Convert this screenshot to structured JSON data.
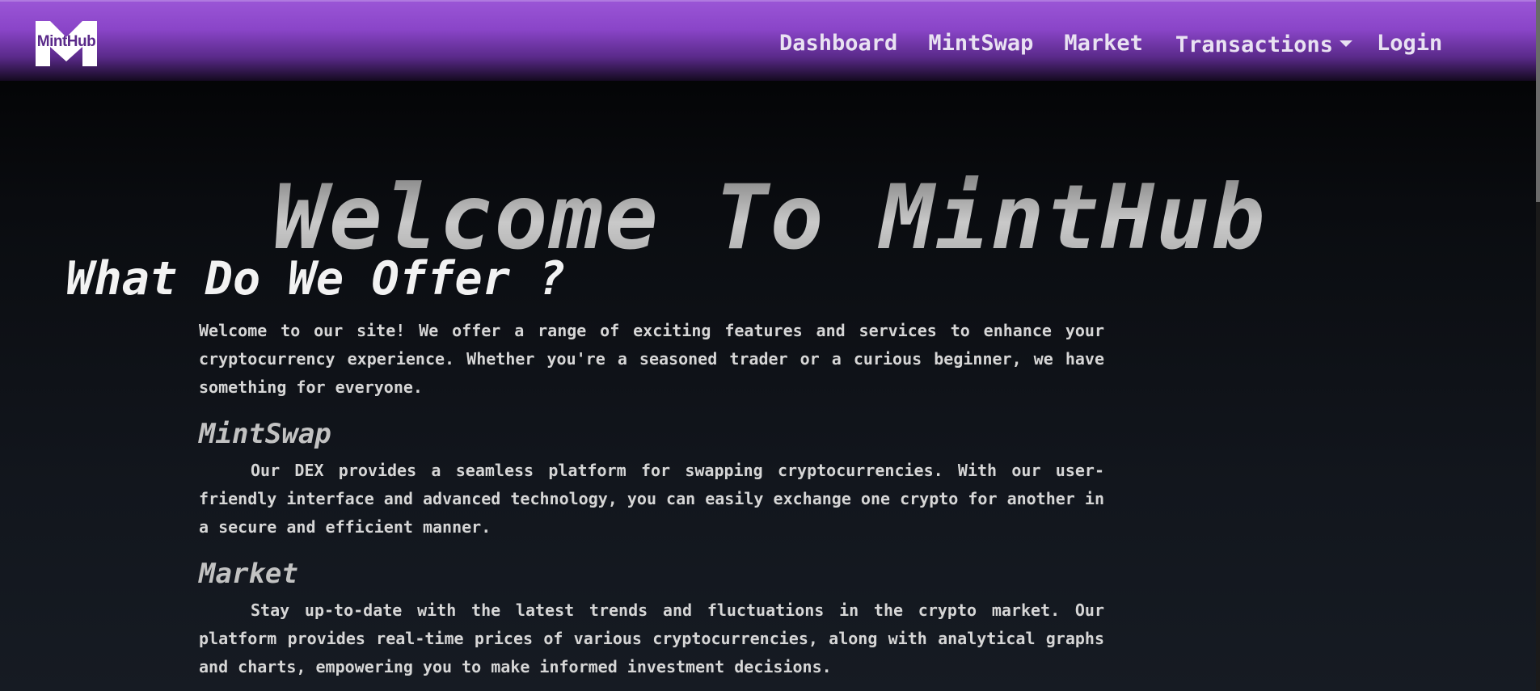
{
  "brand": {
    "logo_letter": "M",
    "logo_text": "MintHub"
  },
  "nav": {
    "dashboard": "Dashboard",
    "mintswap": "MintSwap",
    "market": "Market",
    "transactions": "Transactions",
    "login": "Login"
  },
  "hero": {
    "title": "Welcome To MintHub"
  },
  "offer": {
    "heading": "What Do We Offer ?",
    "intro": "Welcome to our site! We offer a range of exciting features and services to enhance your cryptocurrency experience. Whether you're a seasoned trader or a curious beginner, we have something for everyone.",
    "sections": [
      {
        "title": "MintSwap",
        "text": "Our DEX provides a seamless platform for swapping cryptocurrencies. With our user-friendly interface and advanced technology, you can easily exchange one crypto for another in a secure and efficient manner."
      },
      {
        "title": "Market",
        "text": "Stay up-to-date with the latest trends and fluctuations in the crypto market. Our platform provides real-time prices of various cryptocurrencies, along with analytical graphs and charts, empowering you to make informed investment decisions."
      }
    ]
  },
  "colors": {
    "nav_top": "#9a55d6",
    "nav_bottom": "#140a20",
    "page_bg": "#0a0c10",
    "text": "#d6d6d6"
  },
  "icons": {
    "logo": "minthub-logo-icon",
    "dropdown": "chevron-down-icon"
  }
}
